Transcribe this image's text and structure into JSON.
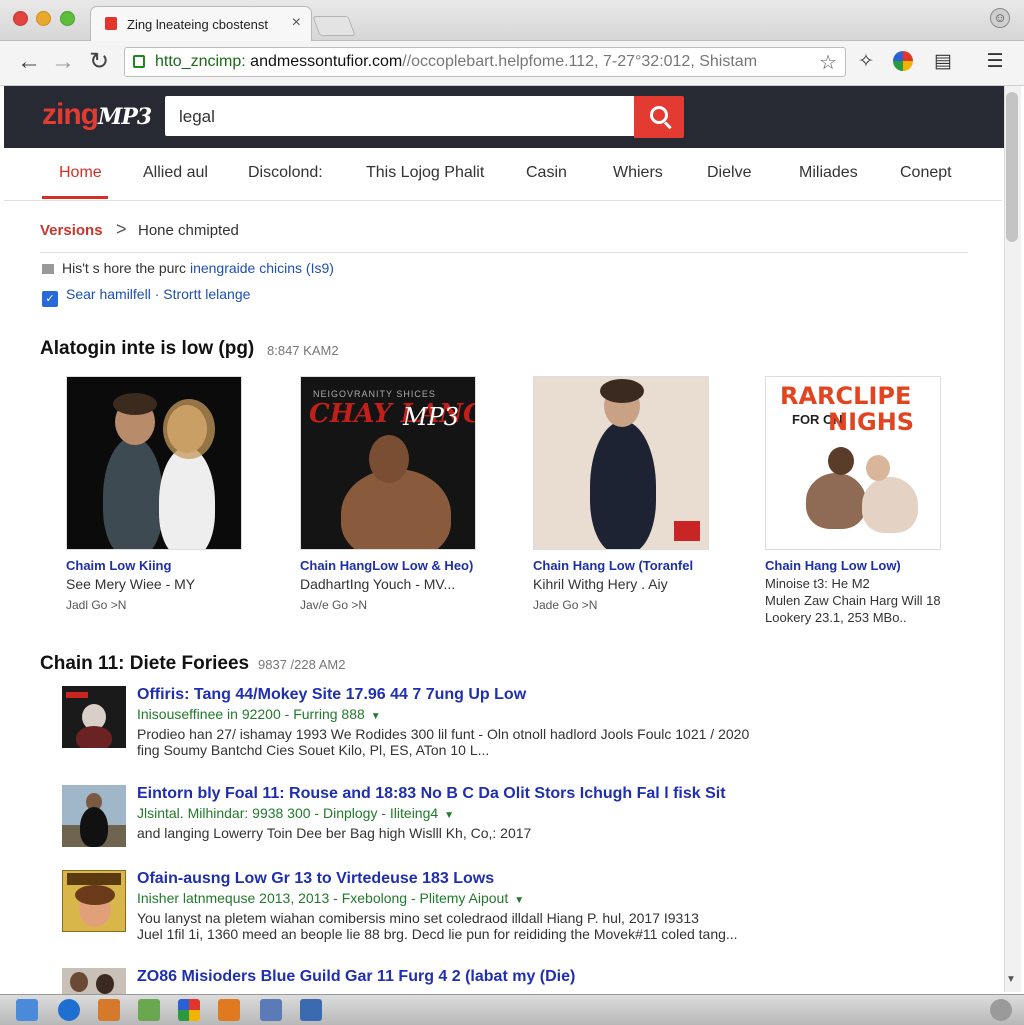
{
  "browser": {
    "tab_title": "Zing lneateing cbostenst",
    "tab_close": "×",
    "url_scheme": "htto_zncimp:",
    "url_host": " andmessontufior.com",
    "url_rest": "//occoplebart.helpfome.112, 7-27°32:012, Shistam",
    "icons": [
      "back-arrow-icon",
      "forward-arrow-icon",
      "reload-icon",
      "lock-icon",
      "star-icon",
      "extension-icon",
      "color-wheel-icon",
      "reader-icon",
      "menu-icon"
    ]
  },
  "site": {
    "logo_main": "zing",
    "logo_mp3": "MP3",
    "search_value": "legal"
  },
  "nav": {
    "items": [
      "Home",
      "Allied aul",
      "Discolond:",
      "This Lojog Phalit",
      "Casin",
      "Whiers",
      "Dielve",
      "Miliades",
      "Conept"
    ]
  },
  "breadcrumb": {
    "first": "Versions",
    "separator": ">",
    "second": "Hone chmipted"
  },
  "info": {
    "line1_text": "His't s hore the purc ",
    "line1_link": "inengraide chicins (Is9)",
    "line2": "Sear hamilfell · Strortt lelange"
  },
  "section1": {
    "title": "Alatogin inte is low (pg)",
    "meta": "8:847 KAM2",
    "cards": [
      {
        "title": "Chaim Low Kiing",
        "sub": "See Mery Wiee - MY",
        "meta": "Jadl Go  >N",
        "art": "couple-portrait"
      },
      {
        "title": "Chain HangLow Low & Heo)",
        "sub": "DadhartIng Youch - MV...",
        "meta": "Jav/e Go >N",
        "art": "chay-lang-cover",
        "art_text": "CHAY LANG",
        "art_small": "NEIGOVRANITY SHICES"
      },
      {
        "title": "Chain Hang Low (Toranfel",
        "sub": "Kihril Withg Hery . Aiy",
        "meta": "Jade Go >N",
        "art": "man-in-suit"
      },
      {
        "title": "Chain Hang Low Low)",
        "sub": "Minoise t3: He M2",
        "sub2": "Mulen Zaw Chain Harg Will 18",
        "meta": "Lookery 23.1, 253 MBo..",
        "art": "barclipe-cover",
        "art_text": "RARCLIPE",
        "art_text2": "NIGHS",
        "art_sub": "FOR ON"
      }
    ]
  },
  "section2": {
    "title": "Chain 11: Diete Foriees",
    "meta": "9837 /228 AM2",
    "results": [
      {
        "title": "Offiris: Tang 44/Mokey Site 17.96 44 7 7ung Up Low",
        "url": "Inisouseffinee in 92200 - Furring 888",
        "desc1": "Prodieo han 27/ ishamay 1993 We Rodides 300 lil funt - Oln otnoll hadlord Jools Foulc 1021 / 2020",
        "desc2": "fing Soumy Bantchd Cies Souet Kilo, Pl, ES, ATon 10 L..."
      },
      {
        "title": "Eintorn bly Foal 11: Rouse and 18:83 No B C Da Olit Stors Ichugh Fal l fisk Sit",
        "url": "Jlsintal. Milhindar: 9938 300 - Dinplogy - Iliteing4",
        "desc1": "and langing Lowerry Toin Dee ber Bag high Wislll Kh, Co,: 2017",
        "desc2": ""
      },
      {
        "title": "Ofain-ausng Low Gr 13 to Virtedeuse 183 Lows",
        "url": "Inisher latnmequse 2013, 2013 - Fxebolong - Plitemy Aipout",
        "desc1": "You lanyst na pletem wiahan comibersis mino set coledraod illdall Hiang P. hul, 2017 I9313",
        "desc2": "Juel 1fil 1i, 1360 meed an beople lie 88 brg. Decd lie pun for reididing the Movek#11 coled tang..."
      },
      {
        "title": "ZO86 Misioders Blue Guild Gar 11 Furg 4 2 (labat my (Die)",
        "url": "",
        "desc1": "",
        "desc2": ""
      }
    ]
  },
  "colors": {
    "brand_red": "#e33b32",
    "header_bg": "#272a33",
    "link_blue": "#1f2fb0",
    "url_green": "#207a2a"
  }
}
